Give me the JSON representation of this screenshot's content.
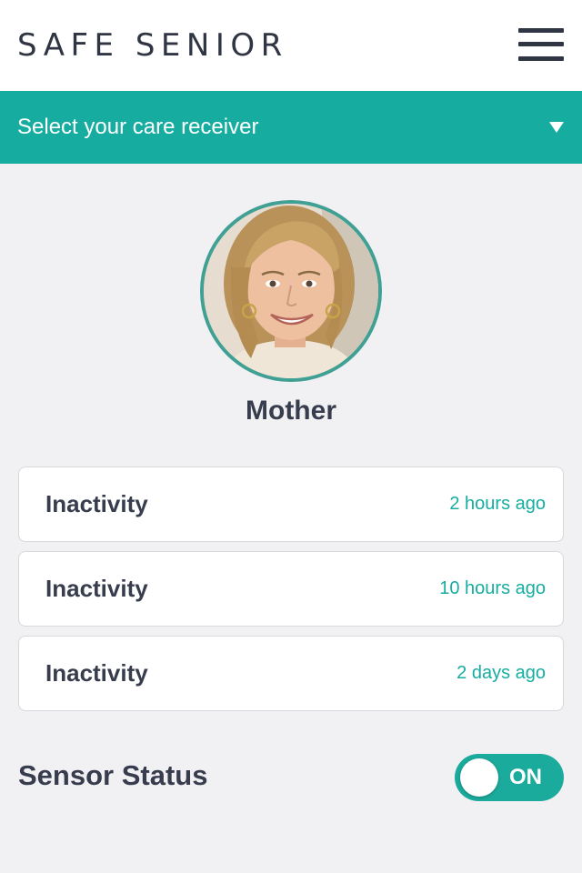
{
  "header": {
    "logo_text": "SAFE SENIOR",
    "menu_icon": "hamburger-menu-icon"
  },
  "selector": {
    "label": "Select your care receiver",
    "caret_icon": "caret-down-icon"
  },
  "profile": {
    "name": "Mother",
    "ring_color": "#3fa093"
  },
  "events": [
    {
      "title": "Inactivity",
      "time": "2 hours ago"
    },
    {
      "title": "Inactivity",
      "time": "10 hours ago"
    },
    {
      "title": "Inactivity",
      "time": "2 days ago"
    }
  ],
  "sensor": {
    "label": "Sensor Status",
    "toggle_text": "ON",
    "enabled": true
  },
  "colors": {
    "accent": "#16ada0",
    "text_dark": "#383d4e",
    "background": "#f1f1f4"
  }
}
